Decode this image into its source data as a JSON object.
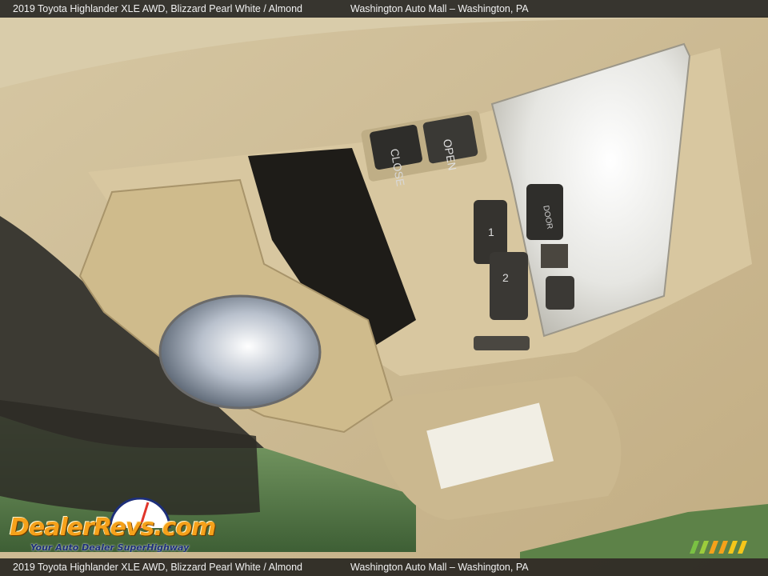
{
  "header": {
    "vehicle": "2019 Toyota Highlander XLE AWD,   Blizzard Pearl White / Almond",
    "dealer": "Washington Auto Mall – Washington, PA"
  },
  "footer": {
    "vehicle": "2019 Toyota Highlander XLE AWD,   Blizzard Pearl White / Almond",
    "dealer": "Washington Auto Mall – Washington, PA"
  },
  "watermark": {
    "logo": "DealerRevs.com",
    "tagline": "Your Auto Dealer SuperHighway"
  },
  "console": {
    "sunroof_close": "CLOSE",
    "sunroof_open": "OPEN",
    "door": "DOOR",
    "button_1": "1",
    "button_2": "2"
  },
  "colors": {
    "headliner": "#cdbb93",
    "console": "#d8c7a0",
    "caption_bar": "#141414",
    "logo_orange": "#f5a11a",
    "tagline_blue": "#1d2f7a"
  }
}
